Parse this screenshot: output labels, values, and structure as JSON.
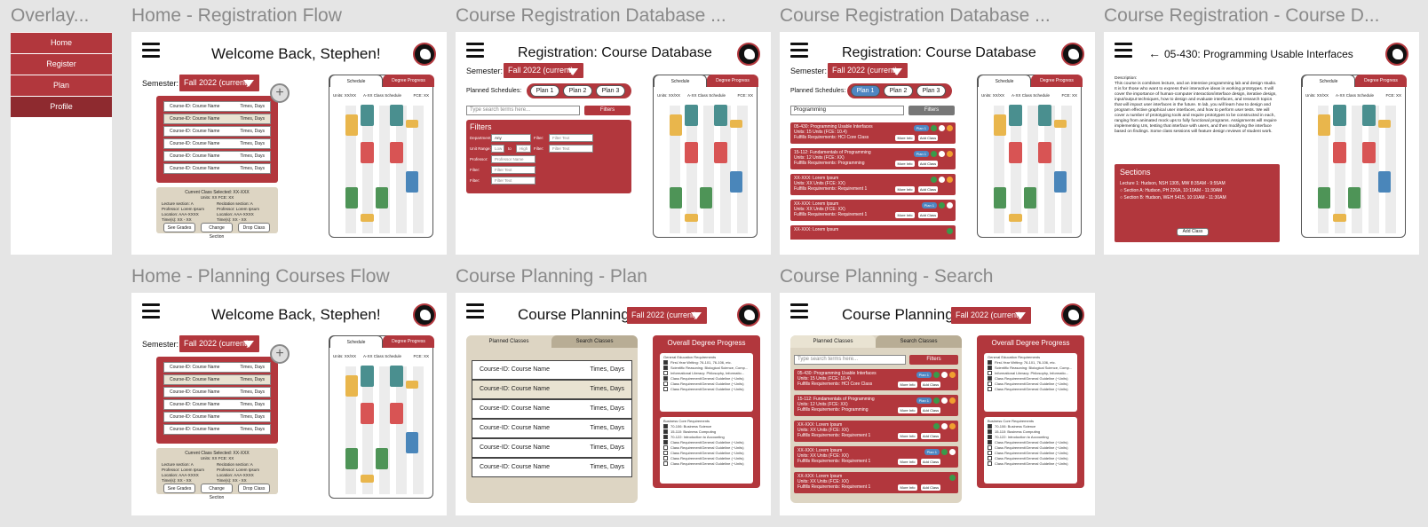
{
  "frame_titles": [
    "Overlay...",
    "Home - Registration Flow",
    "Course Registration Database ...",
    "Course Registration Database ...",
    "Course Registration - Course D...",
    "Home - Planning Courses Flow",
    "Course Planning - Plan",
    "Course Planning - Search"
  ],
  "overlay": {
    "items": [
      "Home",
      "Register",
      "Plan",
      "Profile"
    ]
  },
  "home": {
    "welcome": "Welcome Back, Stephen!",
    "semester_label": "Semester:",
    "semester_value": "Fall 2022 (current)",
    "course_rows": [
      {
        "name": "Course-ID: Course Name",
        "time": "Times, Days"
      },
      {
        "name": "Course-ID: Course Name",
        "time": "Times, Days"
      },
      {
        "name": "Course-ID: Course Name",
        "time": "Times, Days"
      },
      {
        "name": "Course-ID: Course Name",
        "time": "Times, Days"
      },
      {
        "name": "Course-ID: Course Name",
        "time": "Times, Days"
      },
      {
        "name": "Course-ID: Course Name",
        "time": "Times, Days"
      }
    ],
    "selected_title": "Current Class Selected: XX-XXX",
    "selected_units": "Units: XX      FCE: XX",
    "selected_left": [
      "Lecture section: A",
      "Professor: Lorem Ipsum",
      "Location: AAA-XXXX",
      "Time(s): XX - XX"
    ],
    "selected_right": [
      "Recitation section: A",
      "Professor: Lorem Ipsum",
      "Location: AAA-XXXX",
      "Time(s): XX - XX"
    ],
    "buttons": [
      "See Grades",
      "Change Section",
      "Drop Class"
    ]
  },
  "schedule": {
    "tab_schedule": "Schedule",
    "tab_progress": "Degree Progress",
    "units": "Units: XX/XX",
    "title": "A-XX Class Schedule",
    "fce": "FCE: XX"
  },
  "db": {
    "title": "Registration: Course Database",
    "planned_label": "Planned Schedules:",
    "plans": [
      "Plan 1",
      "Plan 2",
      "Plan 3"
    ],
    "search_placeholder": "Type search terms here...",
    "search_value": "Programming",
    "filters_button": "Filters",
    "filters_heading": "Filters",
    "filter_labels": [
      "Department:",
      "Unit Range:",
      "Professor:",
      "Filter:",
      "Filter:"
    ],
    "filter_right_labels": [
      "Filter:",
      "Filter:"
    ],
    "dept_value": "Any",
    "low": "Low",
    "to": "to",
    "high": "High",
    "prof_placeholder": "Professor Name",
    "filter_placeholder": "Filter Text",
    "more_info": "More Info",
    "add_class": "Add Class",
    "results": [
      {
        "l1": "05-430: Programming Usable Interfaces",
        "l2": "Units: 15 Units (FCE: 10.4)",
        "l3": "Fulfills Requirements: HCI Core Class",
        "plan": "Plan 1"
      },
      {
        "l1": "15-112: Fundamentals of Programming",
        "l2": "Units: 12 Units (FCE: XX)",
        "l3": "Fulfills Requirements: Programming",
        "plan": "Plan 1"
      },
      {
        "l1": "XX-XXX: Lorem Ipsum",
        "l2": "Units: XX Units (FCE: XX)",
        "l3": "Fulfills Requirements: Requirement 1",
        "plan": ""
      },
      {
        "l1": "XX-XXX: Lorem Ipsum",
        "l2": "Units: XX Units (FCE: XX)",
        "l3": "Fulfills Requirements: Requirement 1",
        "plan": "Plan 1"
      },
      {
        "l1": "XX-XXX: Lorem Ipsum",
        "l2": "Units: XX Units (FCE: XX)",
        "l3": "Fulfills Requirements: Requirement 1",
        "plan": ""
      }
    ]
  },
  "detail": {
    "title": "05-430: Programming Usable Interfaces",
    "desc_heading": "Description:",
    "desc_text": "This course is combines lecture, and an intensive programming lab and design studio. It is for those who want to express their interactive ideas in working prototypes. It will cover the importance of human-computer interaction/interface design, iterative design, input/output techniques, how to design and evaluate interfaces, and research topics that will impact user interfaces in the future. In lab, you will learn how to design and program effective graphical user interfaces, and how to perform user tests. We will cover a number of prototyping tools and require prototypes to be constructed in each, ranging from animated mock ups to fully functional programs. Assignments will require implementing UIs, testing that interface with users, and then modifying the interface based on findings. Some class sessions will feature design reviews of student work.",
    "sections_heading": "Sections",
    "sections": [
      "Lecture 1: Hudson, NSH 1305, MW 8:35AM - 9:55AM",
      "Section A: Hudson, PH 226A, 10:10AM - 11:30AM",
      "Section B: Hudson, WEH 5415, 10:10AM - 11:30AM"
    ],
    "add_class": "Add Class"
  },
  "planning": {
    "title": "Course Planning:",
    "semester_value": "Fall 2022 (current)",
    "tab_planned": "Planned Classes",
    "tab_search": "Search Classes",
    "rows": [
      {
        "name": "Course-ID: Course Name",
        "time": "Times, Days"
      },
      {
        "name": "Course-ID: Course Name",
        "time": "Times, Days"
      },
      {
        "name": "Course-ID: Course Name",
        "time": "Times, Days"
      },
      {
        "name": "Course-ID: Course Name",
        "time": "Times, Days"
      },
      {
        "name": "Course-ID: Course Name",
        "time": "Times, Days"
      },
      {
        "name": "Course-ID: Course Name",
        "time": "Times, Days"
      }
    ],
    "progress_title": "Overall Degree Progress",
    "gen_ed_heading": "General Education Requirements",
    "gen_ed": [
      "First-Year Writing: 76-101, 76-106, etc.",
      "Scientific Reasoning: Biological Science, Comp...",
      "Informational Literacy: Philosophy, Informatio...",
      "Class Requirement/General Guideline (~Units)",
      "Class Requirement/General Guideline (~Units)",
      "Class Requirement/General Guideline (~Units)"
    ],
    "biz_heading": "Business Core Requirements",
    "biz": [
      "70-106: Business Science",
      "15-110: Business Computing",
      "70-122: Introduction to Accounting",
      "Class Requirement/General Guideline (~Units)",
      "Class Requirement/General Guideline (~Units)",
      "Class Requirement/General Guideline (~Units)",
      "Class Requirement/General Guideline (~Units)",
      "Class Requirement/General Guideline (~Units)"
    ],
    "search_placeholder": "Type search terms here...",
    "filters": "Filters"
  },
  "colors": {
    "accent": "#b2373d",
    "beige": "#ddd5c3",
    "plan_blue": "#4e86c2",
    "green_check": "#3a9a4a"
  }
}
